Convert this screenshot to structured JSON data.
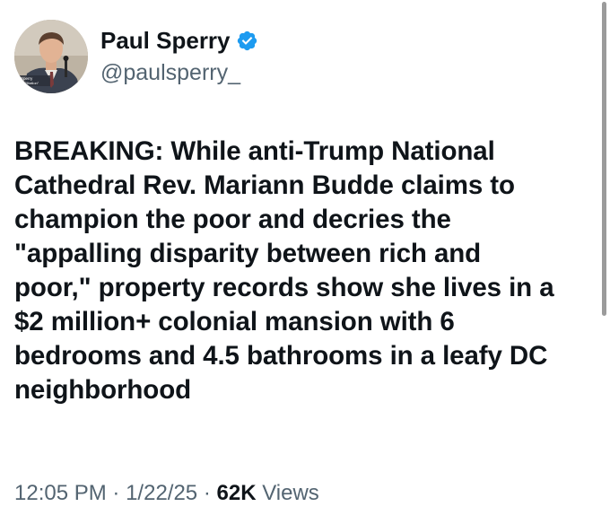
{
  "author": {
    "display_name": "Paul Sperry",
    "handle": "@paulsperry_",
    "verified": true,
    "verified_icon": "verified-badge-icon",
    "verified_color": "#1d9bf0",
    "avatar_caption_line1": "Sperry",
    "avatar_caption_line2": "\"Infiltration\""
  },
  "tweet": {
    "lines": [
      "BREAKING: While anti-Trump National",
      "Cathedral Rev. Mariann Budde claims to",
      "champion the poor and decries the",
      "\"appalling disparity between rich and",
      "poor,\" property records show she lives in a",
      "$2 million+ colonial mansion with 6",
      "bedrooms and 4.5 bathrooms in a leafy DC",
      "neighborhood"
    ]
  },
  "meta": {
    "time": "12:05 PM",
    "separator": "·",
    "date": "1/22/25",
    "views_count": "62K",
    "views_label": "Views"
  },
  "colors": {
    "text_primary": "#0f1419",
    "text_secondary": "#536471",
    "background": "#ffffff"
  }
}
